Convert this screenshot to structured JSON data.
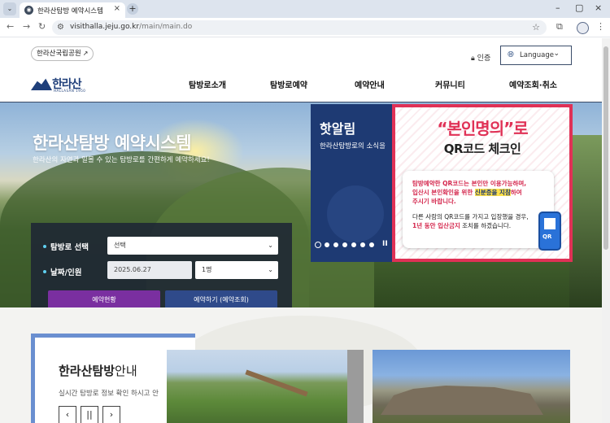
{
  "browser": {
    "tab_title": "한라산탐방 예약시스템",
    "tab_close": "×",
    "new_tab": "+",
    "url_host": "visithalla.jeju.go.kr",
    "url_path": "/main/main.do",
    "window_controls": [
      "–",
      "▢",
      "×"
    ]
  },
  "header": {
    "park_link": "한라산국립공원",
    "auth_label": "인증",
    "language_label": "Language",
    "logo_text": "한라산",
    "logo_sub": "HALLASAN 1950",
    "nav": [
      "탐방로소개",
      "탐방로예약",
      "예약안내",
      "커뮤니티",
      "예약조회·취소"
    ]
  },
  "hero": {
    "title": "한라산탐방 예약시스템",
    "subtitle": "한라산의 자연과 일몰 수 있는 탐방로를 간편하게 예약하세요!"
  },
  "reservation": {
    "trail_label": "탐방로 선택",
    "trail_value": "선택",
    "date_label": "날짜/인원",
    "date_value": "2025.06.27",
    "people_value": "1명",
    "status_button": "예약현황",
    "reserve_button": "예약하기 (예약조회)",
    "colors": {
      "status": "#7a2fa0",
      "reserve": "#2f4a8a"
    }
  },
  "notice": {
    "title": "핫알림",
    "subtitle": "한라산탐방로의 소식을",
    "poster_title": "“본인명의”로",
    "poster_subtitle": "QR코드 체크인",
    "line1": "탐방예약한 QR코드는 본인만 이용가능하며,",
    "line2_a": "입산시 본인확인을 위한 ",
    "line2_b": "신분증을 지참",
    "line2_c": "하여",
    "line3": "주시기 바랍니다.",
    "line4": "다른 사람의 QR코드를 가지고 입장했을 경우,",
    "line5_a": "1년 동안 입산금지",
    "line5_b": " 조치를 하겠습니다.",
    "phone_label": "QR",
    "pause": "II"
  },
  "guide": {
    "title_bold": "한라산탐방",
    "title_rest": "안내",
    "subtitle": "실시간 탐방로 정보 확인 하시고 안",
    "prev": "‹",
    "pause": "||",
    "next": "›"
  }
}
